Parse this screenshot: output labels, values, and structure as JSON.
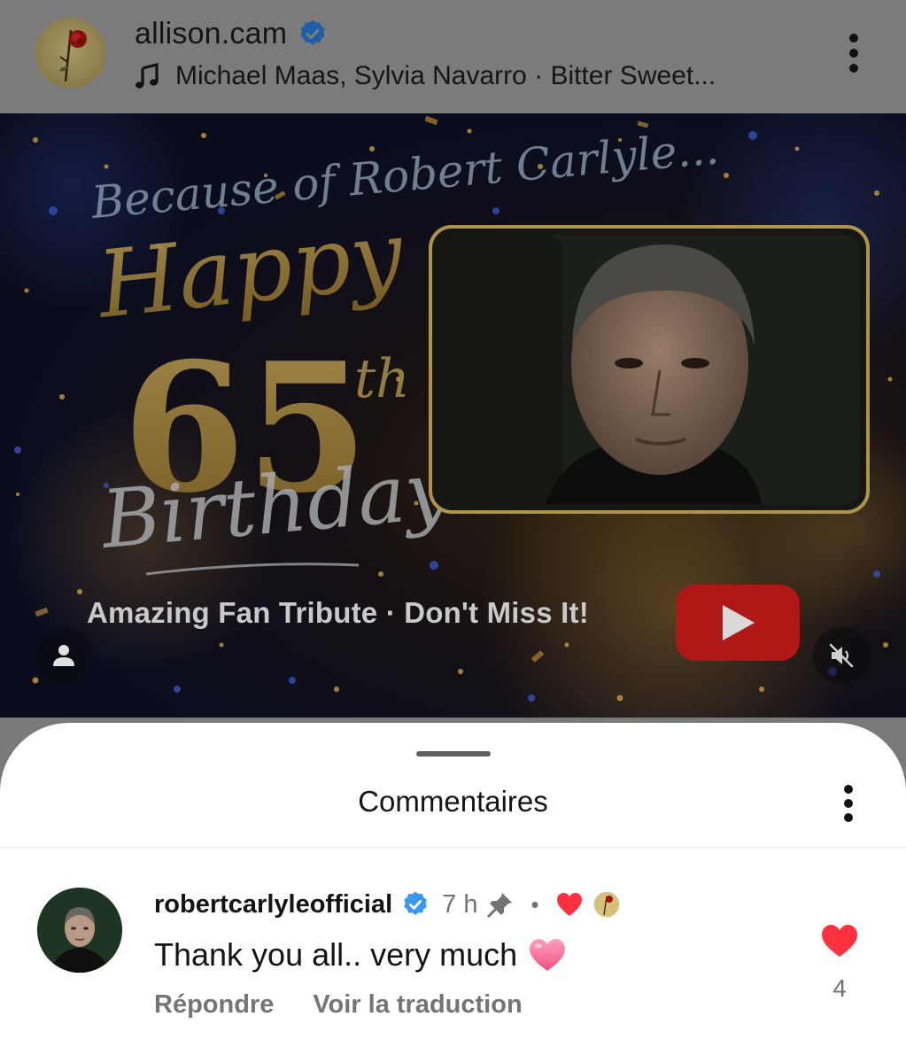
{
  "post": {
    "username": "allison.cam",
    "verified": true,
    "audio": "Michael Maas, Sylvia Navarro · Bitter Sweet..."
  },
  "media": {
    "graphic_text": {
      "line1": "Because of Robert Carlyle...",
      "line2": "Happy",
      "number": "65",
      "suffix": "th",
      "line3": "Birthday"
    },
    "caption": "Amazing Fan Tribute · Don't Miss It!",
    "buttons": {
      "tagged_people_icon": "person-icon",
      "play_icon": "youtube-play-icon",
      "mute_icon": "speaker-muted-icon"
    }
  },
  "comments_sheet": {
    "title": "Commentaires",
    "comments": [
      {
        "username": "robertcarlyleofficial",
        "verified": true,
        "time": "7 h",
        "pinned": true,
        "separator": "•",
        "text": "Thank you all.. very much",
        "reply_label": "Répondre",
        "translate_label": "Voir la traduction",
        "likes": "4"
      }
    ]
  },
  "colors": {
    "verified_blue": "#3897f0",
    "like_red": "#ff3040",
    "sheet_bg": "#ffffff",
    "dim_overlay": "#7b7b7b",
    "youtube_red": "#b01818"
  }
}
